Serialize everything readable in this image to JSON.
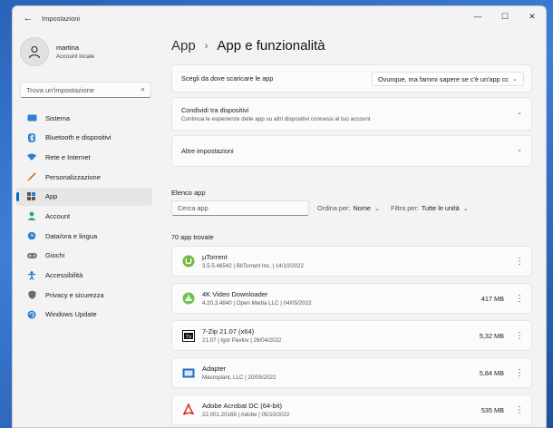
{
  "window": {
    "title": "Impostazioni",
    "back_glyph": "←",
    "minimize": "—",
    "maximize": "☐",
    "close": "✕"
  },
  "profile": {
    "name": "martina",
    "account": "Account locale"
  },
  "search": {
    "placeholder": "Trova un'impostazione"
  },
  "sidebar": {
    "items": [
      {
        "label": "Sistema",
        "icon": "system-icon"
      },
      {
        "label": "Bluetooth e dispositivi",
        "icon": "bluetooth-icon"
      },
      {
        "label": "Rete e Internet",
        "icon": "wifi-icon"
      },
      {
        "label": "Personalizzazione",
        "icon": "brush-icon"
      },
      {
        "label": "App",
        "icon": "apps-icon",
        "active": true
      },
      {
        "label": "Account",
        "icon": "account-icon"
      },
      {
        "label": "Data/ora e lingua",
        "icon": "globe-clock-icon"
      },
      {
        "label": "Giochi",
        "icon": "gamepad-icon"
      },
      {
        "label": "Accessibilità",
        "icon": "accessibility-icon"
      },
      {
        "label": "Privacy e sicurezza",
        "icon": "shield-icon"
      },
      {
        "label": "Windows Update",
        "icon": "update-icon"
      }
    ]
  },
  "breadcrumb": {
    "parent": "App",
    "separator": "›",
    "current": "App e funzionalità"
  },
  "settings": {
    "download_source": {
      "label": "Scegli da dove scaricare le app",
      "value": "Ovunque, ma fammi sapere se c'è un'app cc"
    },
    "share_devices": {
      "label": "Condividi tra dispositivi",
      "description": "Continua le esperienze delle app su altri dispositivi connessi al tuo account"
    },
    "more_settings": {
      "label": "Altre impostazioni"
    }
  },
  "app_list": {
    "heading": "Elenco app",
    "search_placeholder": "Cerca app",
    "sort_label": "Ordina per:",
    "sort_value": "Nome",
    "filter_label": "Filtra per:",
    "filter_value": "Tutte le unità",
    "count": "70 app trovate",
    "apps": [
      {
        "name": "µTorrent",
        "meta": "3.5.5.46542  |  BitTorrent Inc.  |  14/10/2022",
        "size": "",
        "icon": "utorrent-icon"
      },
      {
        "name": "4K Video Downloader",
        "meta": "4.20.3.4840  |  Open Media LLC  |  04/05/2022",
        "size": "417 MB",
        "icon": "4k-downloader-icon"
      },
      {
        "name": "7-Zip 21.07 (x64)",
        "meta": "21.07  |  Igor Pavlov  |  26/04/2022",
        "size": "5,32 MB",
        "icon": "7zip-icon"
      },
      {
        "name": "Adapter",
        "meta": "Macroplant, LLC  |  20/05/2022",
        "size": "5,84 MB",
        "icon": "adapter-icon"
      },
      {
        "name": "Adobe Acrobat DC (64-bit)",
        "meta": "22.001.20169  |  Adobe  |  05/10/2022",
        "size": "535 MB",
        "icon": "acrobat-icon"
      }
    ]
  },
  "colors": {
    "accent": "#0067c0",
    "window_bg": "#f3f3f3",
    "card_bg": "#fbfbfb"
  }
}
